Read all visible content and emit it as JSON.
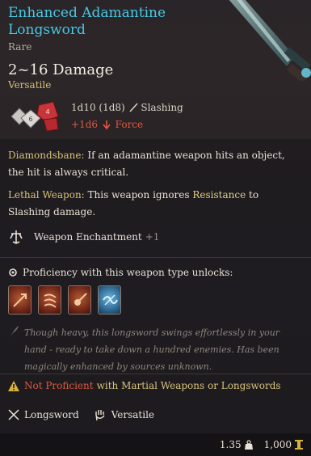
{
  "item": {
    "title": "Enhanced Adamantine Longsword",
    "rarity": "Rare",
    "damage": "2~16 Damage",
    "property": "Versatile",
    "dice_line": "1d10 (1d8)",
    "damage_type": "Slashing",
    "bonus_dice": "+1d6",
    "bonus_type": "Force"
  },
  "abilities": [
    {
      "name": "Diamondsbane:",
      "text": "If an adamantine weapon hits an object, the hit is always critical."
    },
    {
      "name": "Lethal Weapon:",
      "text_before": "This weapon ignores",
      "keyword": "Resistance",
      "text_after": "to Slashing damage."
    }
  ],
  "enchantment": {
    "label": "Weapon Enchantment",
    "bonus": "+1"
  },
  "proficiency": {
    "label": "Proficiency with this weapon type unlocks:",
    "actions": [
      {
        "icon": "cleave-icon",
        "color": "red"
      },
      {
        "icon": "lacerate-icon",
        "color": "red"
      },
      {
        "icon": "pommel-strike-icon",
        "color": "red"
      },
      {
        "icon": "flourish-icon",
        "color": "blue"
      }
    ]
  },
  "flavor": "Though heavy, this longsword swings effortlessly in your hand - ready to take down a hundred enemies. Has been magically enhanced by sources unknown.",
  "warning": {
    "not_proficient": "Not Proficient",
    "rest": "with Martial Weapons or Longswords"
  },
  "properties": [
    {
      "icon": "crossed-swords-icon",
      "label": "Longsword"
    },
    {
      "icon": "hand-icon",
      "label": "Versatile"
    }
  ],
  "footer": {
    "weight": "1.35",
    "value": "1,000"
  },
  "colors": {
    "title": "#47c9e4",
    "accent": "#d8c27a",
    "force": "#e0573f"
  }
}
